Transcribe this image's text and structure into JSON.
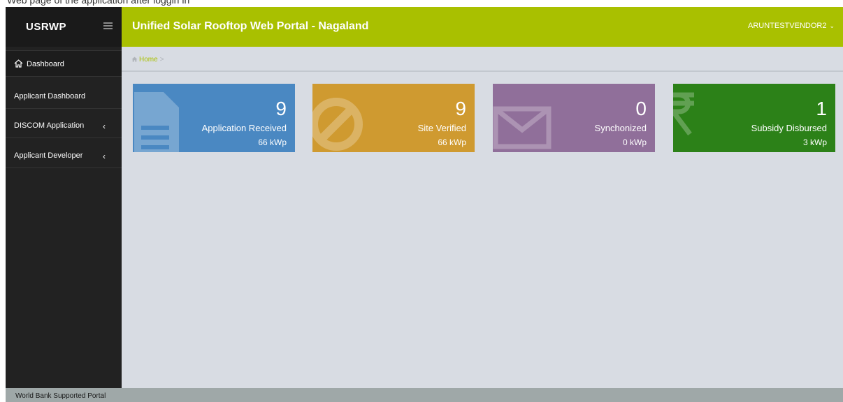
{
  "page_caption": "Web page of the application after loggin in",
  "brand": {
    "title": "USRWP"
  },
  "header": {
    "title": "Unified Solar Rooftop Web Portal - Nagaland",
    "user": "ARUNTESTVENDOR2"
  },
  "sidebar": {
    "items": [
      {
        "label": "Dashboard",
        "icon": "home-icon"
      },
      {
        "label": "Applicant Dashboard"
      },
      {
        "label": "DISCOM Application",
        "chevron": "‹"
      },
      {
        "label": "Applicant Developer",
        "chevron": "‹"
      }
    ]
  },
  "breadcrumb": {
    "home": "Home",
    "separator": ">"
  },
  "cards": [
    {
      "value": "9",
      "label": "Application Received",
      "capacity": "66 kWp",
      "color": "#4a88c2",
      "icon": "document-icon"
    },
    {
      "value": "9",
      "label": "Site Verified",
      "capacity": "66 kWp",
      "color": "#cf9a30",
      "icon": "ban-icon"
    },
    {
      "value": "0",
      "label": "Synchonized",
      "capacity": "0 kWp",
      "color": "#906f9a",
      "icon": "envelope-icon"
    },
    {
      "value": "1",
      "label": "Subsidy Disbursed",
      "capacity": "3 kWp",
      "color": "#2c8118",
      "icon": "rupee-icon"
    }
  ],
  "footer": {
    "text": "World Bank Supported Portal"
  },
  "colors": {
    "header": "#a9c000",
    "sidebar": "#222222",
    "content": "#d8dce3",
    "footer": "#9fa8a8"
  }
}
